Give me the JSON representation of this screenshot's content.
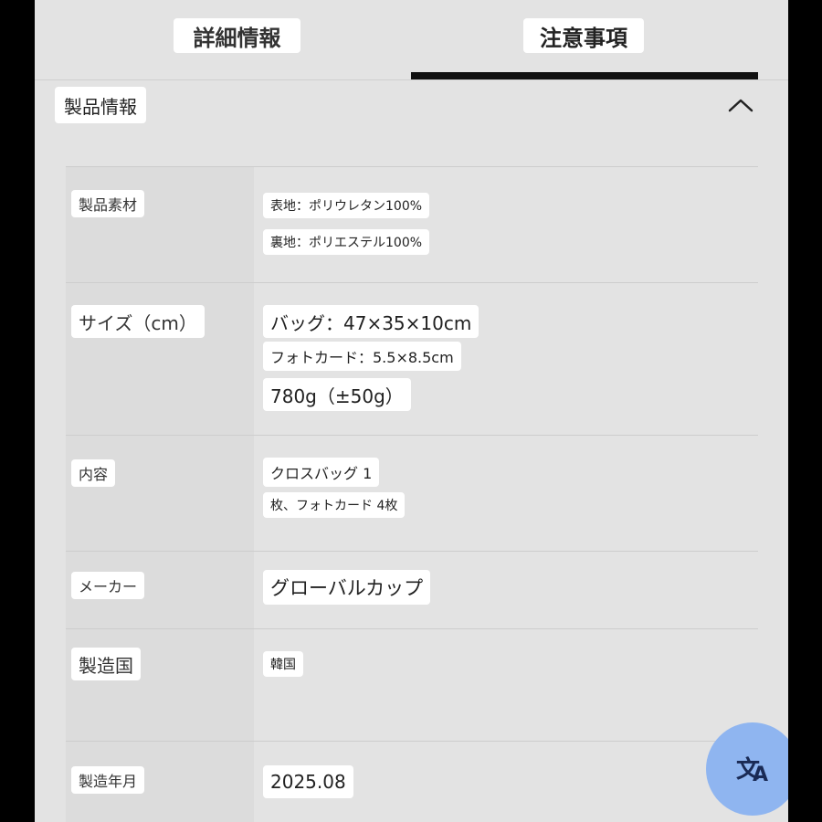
{
  "tabs": [
    {
      "label": "詳細情報",
      "active": false
    },
    {
      "label": "注意事項",
      "active": true
    }
  ],
  "section": {
    "title": "製品情報",
    "collapse_icon": "chevron-up-icon"
  },
  "rows": [
    {
      "label": "製品素材",
      "values": [
        "表地：ポリウレタン100%",
        "裏地：ポリエステル100%"
      ]
    },
    {
      "label": "サイズ（cm）",
      "values": [
        "バッグ：47×35×10cm",
        "フォトカード：5.5×8.5cm",
        "780g（±50g）"
      ]
    },
    {
      "label": "内容",
      "values": [
        "クロスバッグ 1",
        "枚、フォトカード 4枚"
      ]
    },
    {
      "label": "メーカー",
      "values": [
        "グローバルカップ"
      ]
    },
    {
      "label": "製造国",
      "values": [
        "韓国"
      ]
    },
    {
      "label": "製造年月",
      "values": [
        "2025.08"
      ]
    }
  ],
  "translate_button": {
    "icon": "translate-icon",
    "glyph_primary": "文",
    "glyph_secondary": "A",
    "color": "#8fb5f0"
  },
  "colors": {
    "panel_bg": "#e3e3e3",
    "label_cell_bg": "#dcdcdc",
    "tab_underline": "#111111"
  }
}
